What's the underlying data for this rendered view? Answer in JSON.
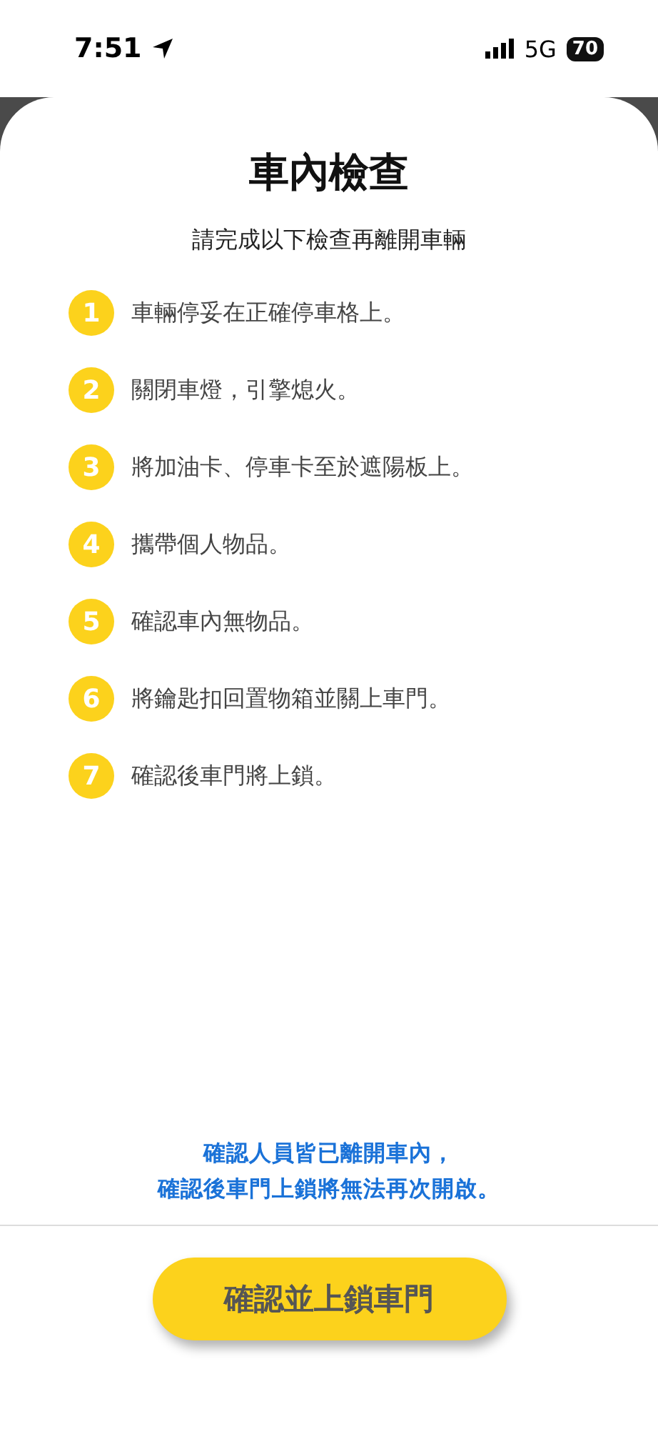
{
  "status_bar": {
    "time": "7:51",
    "network": "5G",
    "battery": "70"
  },
  "title": "車內檢查",
  "subtitle": "請完成以下檢查再離開車輛",
  "steps": [
    {
      "number": "1",
      "text": "車輛停妥在正確停車格上。"
    },
    {
      "number": "2",
      "text": "關閉車燈，引擎熄火。"
    },
    {
      "number": "3",
      "text": "將加油卡、停車卡至於遮陽板上。"
    },
    {
      "number": "4",
      "text": "攜帶個人物品。"
    },
    {
      "number": "5",
      "text": "確認車內無物品。"
    },
    {
      "number": "6",
      "text": "將鑰匙扣回置物箱並關上車門。"
    },
    {
      "number": "7",
      "text": "確認後車門將上鎖。"
    }
  ],
  "notice": [
    "確認人員皆已離開車內，",
    "確認後車門上鎖將無法再次開啟。"
  ],
  "confirm_button": "確認並上鎖車門"
}
